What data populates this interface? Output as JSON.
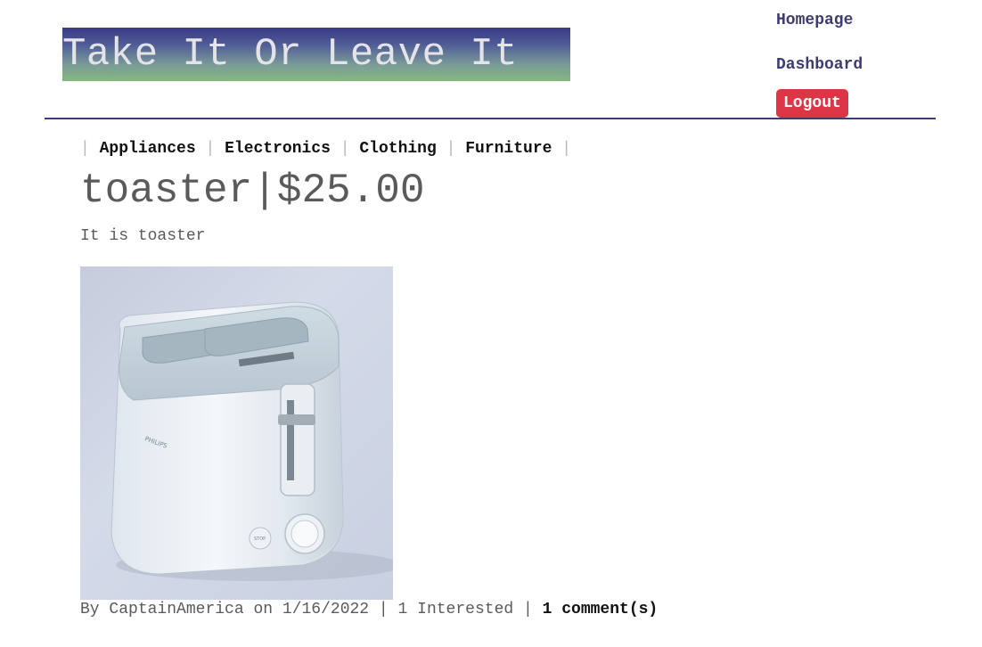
{
  "header": {
    "logo_text": "Take It Or Leave It",
    "nav": {
      "homepage": "Homepage",
      "dashboard": "Dashboard",
      "logout": "Logout"
    }
  },
  "categories": {
    "separator": "|",
    "items": [
      "Appliances",
      "Electronics",
      "Clothing",
      "Furniture"
    ]
  },
  "product": {
    "name": "toaster",
    "title_separator": "|",
    "price": "$25.00",
    "description": "It is toaster",
    "image_brand": "PHILIPS",
    "image_button_label": "STOP"
  },
  "meta": {
    "by_label": "By",
    "author": "CaptainAmerica",
    "on_label": "on",
    "date": "1/16/2022",
    "separator": "|",
    "interested": "1 Interested",
    "comments": "1 comment(s)"
  },
  "colors": {
    "brand": "#3d3c72",
    "logout": "#dc3545",
    "muted_text": "#5a5a5a"
  }
}
